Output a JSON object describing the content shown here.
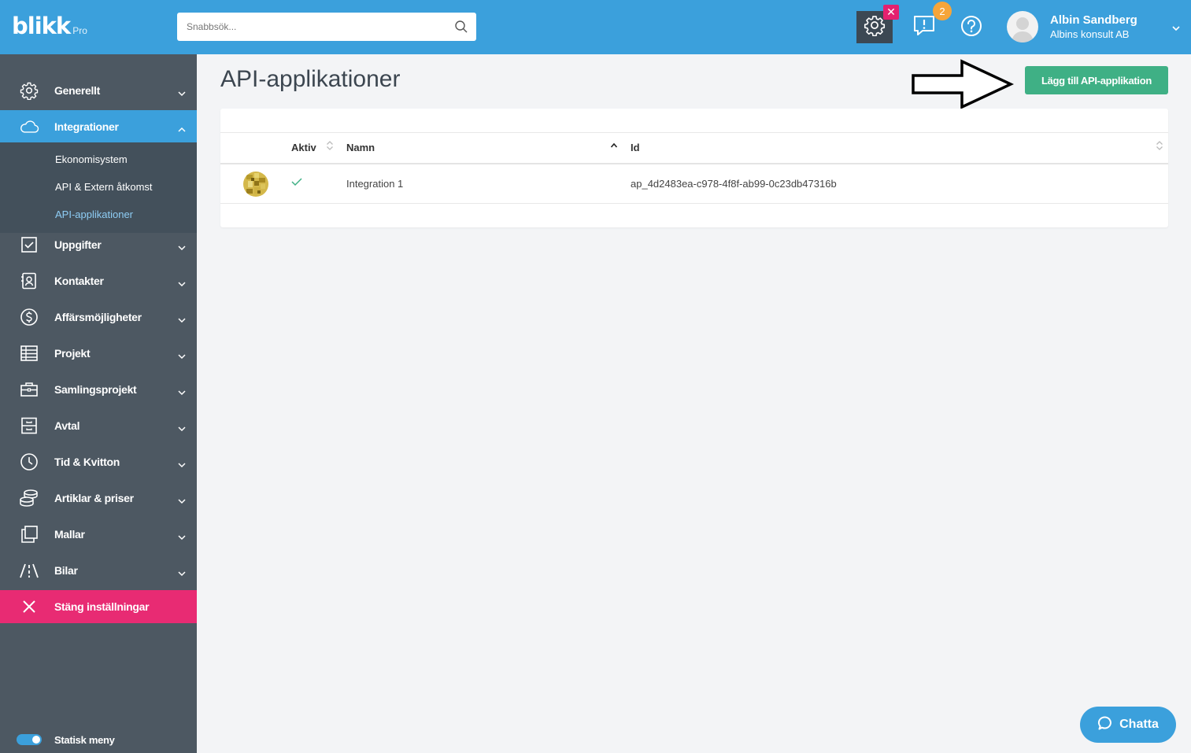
{
  "header": {
    "logo_text": "blikk",
    "logo_sub": "Pro",
    "search_placeholder": "Snabbsök...",
    "notification_count": "2",
    "user": {
      "name": "Albin Sandberg",
      "org": "Albins konsult AB"
    }
  },
  "sidebar": {
    "items": [
      {
        "label": "Generellt",
        "icon": "gear-icon"
      },
      {
        "label": "Integrationer",
        "icon": "cloud-icon",
        "active": true
      },
      {
        "label": "Uppgifter",
        "icon": "checkbox-icon"
      },
      {
        "label": "Kontakter",
        "icon": "contact-book-icon"
      },
      {
        "label": "Affärsmöjligheter",
        "icon": "dollar-icon"
      },
      {
        "label": "Projekt",
        "icon": "table-icon"
      },
      {
        "label": "Samlingsprojekt",
        "icon": "briefcase-icon"
      },
      {
        "label": "Avtal",
        "icon": "cabinet-icon"
      },
      {
        "label": "Tid & Kvitton",
        "icon": "clock-icon"
      },
      {
        "label": "Artiklar & priser",
        "icon": "coins-icon"
      },
      {
        "label": "Mallar",
        "icon": "copy-icon"
      },
      {
        "label": "Bilar",
        "icon": "road-icon"
      }
    ],
    "subitems": [
      {
        "label": "Ekonomisystem"
      },
      {
        "label": "API & Extern åtkomst"
      },
      {
        "label": "API-applikationer",
        "current": true
      }
    ],
    "close_label": "Stäng inställningar",
    "static_menu_label": "Statisk meny"
  },
  "main": {
    "title": "API-applikationer",
    "add_button": "Lägg till API-applikation",
    "table": {
      "columns": [
        "Aktiv",
        "Namn",
        "Id"
      ],
      "rows": [
        {
          "active": true,
          "name": "Integration 1",
          "id": "ap_4d2483ea-c978-4f8f-ab99-0c23db47316b"
        }
      ]
    }
  },
  "chat": {
    "label": "Chatta"
  },
  "colors": {
    "brand_blue": "#3ba0dc",
    "sidebar_bg": "#4d5862",
    "close_pink": "#e82b73",
    "add_green": "#3fb085",
    "badge_orange": "#f6a53a"
  }
}
